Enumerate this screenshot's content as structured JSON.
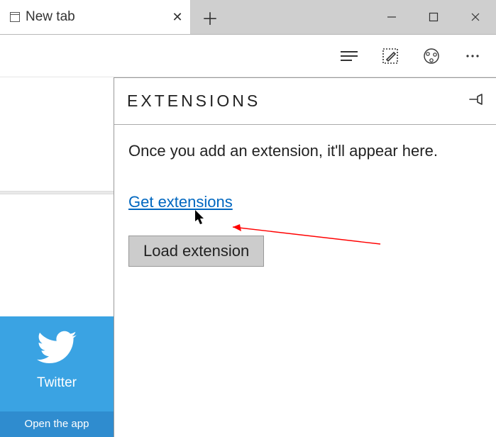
{
  "titlebar": {
    "tab_title": "New tab"
  },
  "panel": {
    "heading": "EXTENSIONS",
    "message": "Once you add an extension, it'll appear here.",
    "get_link": "Get extensions",
    "load_button": "Load extension"
  },
  "tile": {
    "label": "Twitter",
    "footer": "Open the app"
  }
}
